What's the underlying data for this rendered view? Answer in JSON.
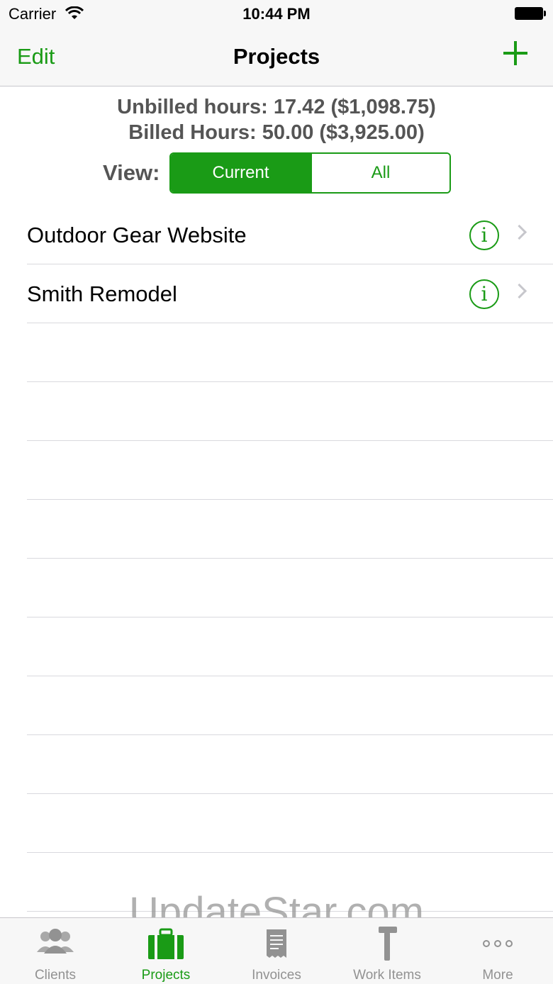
{
  "status": {
    "carrier": "Carrier",
    "time": "10:44 PM"
  },
  "nav": {
    "edit": "Edit",
    "title": "Projects"
  },
  "summary": {
    "unbilled": "Unbilled hours: 17.42 ($1,098.75)",
    "billed": "Billed Hours: 50.00 ($3,925.00)"
  },
  "view": {
    "label": "View:",
    "current": "Current",
    "all": "All",
    "selected": "Current"
  },
  "projects": [
    {
      "name": "Outdoor Gear Website"
    },
    {
      "name": "Smith Remodel"
    }
  ],
  "tabs": [
    {
      "label": "Clients",
      "icon": "clients-icon"
    },
    {
      "label": "Projects",
      "icon": "briefcase-icon"
    },
    {
      "label": "Invoices",
      "icon": "receipt-icon"
    },
    {
      "label": "Work Items",
      "icon": "hammer-icon"
    },
    {
      "label": "More",
      "icon": "more-icon"
    }
  ],
  "active_tab": "Projects",
  "watermark": "UpdateStar.com",
  "colors": {
    "accent": "#1a9b16",
    "inactive": "#929292"
  }
}
